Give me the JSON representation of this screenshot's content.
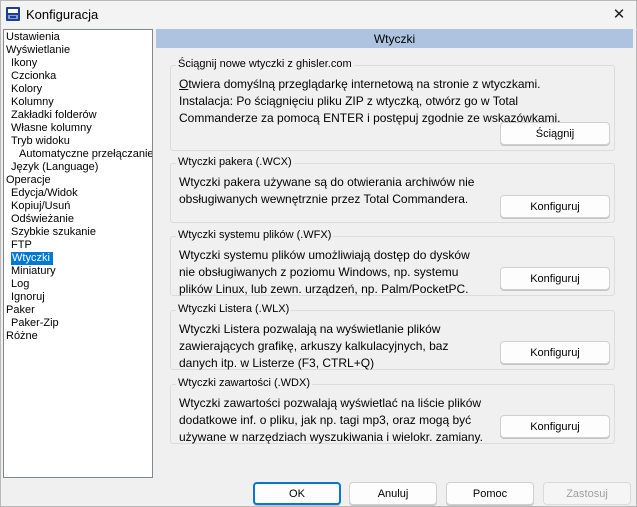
{
  "window": {
    "title": "Konfiguracja",
    "close_glyph": "✕"
  },
  "tree": {
    "items": [
      {
        "label": "Ustawienia",
        "level": 0
      },
      {
        "label": "Wyświetlanie",
        "level": 0
      },
      {
        "label": "Ikony",
        "level": 1
      },
      {
        "label": "Czcionka",
        "level": 1
      },
      {
        "label": "Kolory",
        "level": 1
      },
      {
        "label": "Kolumny",
        "level": 1
      },
      {
        "label": "Zakładki folderów",
        "level": 1
      },
      {
        "label": "Własne kolumny",
        "level": 1
      },
      {
        "label": "Tryb widoku",
        "level": 1
      },
      {
        "label": "Automatyczne przełączanie",
        "level": 2
      },
      {
        "label": "Język (Language)",
        "level": 1
      },
      {
        "label": "Operacje",
        "level": 0
      },
      {
        "label": "Edycja/Widok",
        "level": 1
      },
      {
        "label": "Kopiuj/Usuń",
        "level": 1
      },
      {
        "label": "Odświeżanie",
        "level": 1
      },
      {
        "label": "Szybkie szukanie",
        "level": 1
      },
      {
        "label": "FTP",
        "level": 1
      },
      {
        "label": "Wtyczki",
        "level": 1,
        "selected": true
      },
      {
        "label": "Miniatury",
        "level": 1
      },
      {
        "label": "Log",
        "level": 1
      },
      {
        "label": "Ignoruj",
        "level": 1
      },
      {
        "label": "Paker",
        "level": 0
      },
      {
        "label": "Paker-Zip",
        "level": 1
      },
      {
        "label": "Różne",
        "level": 0
      }
    ]
  },
  "header": {
    "title": "Wtyczki"
  },
  "groups": {
    "download": {
      "title": "Ściągnij nowe wtyczki z ghisler.com",
      "lines": [
        "Otwiera domyślną przeglądarkę internetową na stronie z wtyczkami.",
        "Instalacja: Po ściągnięciu pliku ZIP z wtyczką, otwórz go w Total",
        "Commanderze za pomocą ENTER i postępuj zgodnie ze wskazówkami."
      ],
      "button": "Ściągnij"
    },
    "wcx": {
      "title": "Wtyczki pakera (.WCX)",
      "lines": [
        "Wtyczki pakera używane są do otwierania archiwów nie",
        "obsługiwanych wewnętrznie przez Total Commandera."
      ],
      "button": "Konfiguruj"
    },
    "wfx": {
      "title": "Wtyczki systemu plików (.WFX)",
      "lines": [
        "Wtyczki systemu plików umożliwiają dostęp do dysków",
        "nie obsługiwanych z poziomu Windows, np. systemu",
        "plików Linux, lub zewn. urządzeń, np. Palm/PocketPC."
      ],
      "button": "Konfiguruj"
    },
    "wlx": {
      "title": "Wtyczki Listera (.WLX)",
      "lines": [
        "Wtyczki Listera pozwalają na wyświetlanie plików",
        "zawierających grafikę, arkuszy kalkulacyjnych, baz",
        "danych itp. w Listerze (F3, CTRL+Q)"
      ],
      "button": "Konfiguruj"
    },
    "wdx": {
      "title": "Wtyczki zawartości (.WDX)",
      "lines": [
        "Wtyczki zawartości pozwalają wyświetlać na liście plików",
        "dodatkowe inf. o pliku, jak np. tagi mp3, oraz mogą być",
        "używane w narzędziach wyszukiwania i wielokr. zamiany."
      ],
      "button": "Konfiguruj"
    }
  },
  "footer": {
    "ok": "OK",
    "cancel": "Anuluj",
    "help": "Pomoc",
    "apply": "Zastosuj"
  },
  "colors": {
    "header_bg": "#adc3e0",
    "selection": "#0078d7",
    "primary_border": "#0078d4"
  }
}
